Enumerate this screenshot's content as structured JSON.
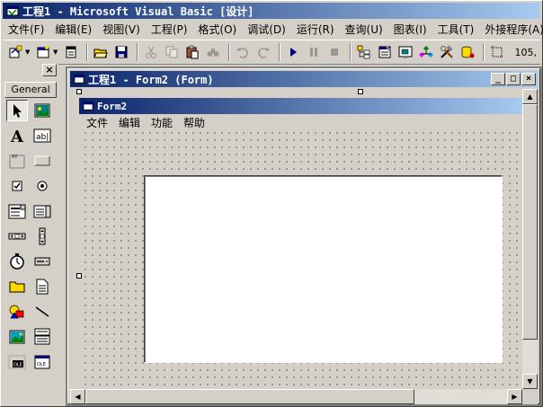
{
  "app": {
    "title": "工程1 - Microsoft Visual Basic [设计]"
  },
  "menubar": {
    "items": [
      "文件(F)",
      "编辑(E)",
      "视图(V)",
      "工程(P)",
      "格式(O)",
      "调试(D)",
      "运行(R)",
      "查询(U)",
      "图表(I)",
      "工具(T)",
      "外接程序(A)"
    ]
  },
  "toolbar": {
    "coords": "105,"
  },
  "toolbox": {
    "close_label": "×",
    "tab_label": "General"
  },
  "child_window": {
    "title": "工程1 - Form2 (Form)",
    "min": "_",
    "max": "□",
    "close": "×"
  },
  "form": {
    "title": "Form2",
    "menu": [
      "文件",
      "编辑",
      "功能",
      "帮助"
    ]
  },
  "colors": {
    "title_active_start": "#0a246a",
    "title_active_end": "#a6caf0",
    "face": "#d4d0c8"
  }
}
